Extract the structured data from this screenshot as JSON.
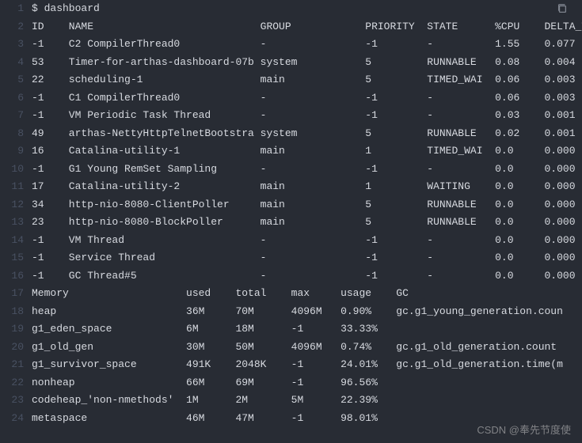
{
  "prompt": "$ dashboard",
  "thread_header": {
    "id": "ID",
    "name": "NAME",
    "group": "GROUP",
    "priority": "PRIORITY",
    "state": "STATE",
    "cpu": "%CPU",
    "delta": "DELTA_T"
  },
  "threads": [
    {
      "id": "-1",
      "name": "C2 CompilerThread0",
      "group": "-",
      "priority": "-1",
      "state": "-",
      "cpu": "1.55",
      "delta": "0.077"
    },
    {
      "id": "53",
      "name": "Timer-for-arthas-dashboard-07b",
      "group": "system",
      "priority": "5",
      "state": "RUNNABLE",
      "cpu": "0.08",
      "delta": "0.004"
    },
    {
      "id": "22",
      "name": "scheduling-1",
      "group": "main",
      "priority": "5",
      "state": "TIMED_WAI",
      "cpu": "0.06",
      "delta": "0.003"
    },
    {
      "id": "-1",
      "name": "C1 CompilerThread0",
      "group": "-",
      "priority": "-1",
      "state": "-",
      "cpu": "0.06",
      "delta": "0.003"
    },
    {
      "id": "-1",
      "name": "VM Periodic Task Thread",
      "group": "-",
      "priority": "-1",
      "state": "-",
      "cpu": "0.03",
      "delta": "0.001"
    },
    {
      "id": "49",
      "name": "arthas-NettyHttpTelnetBootstra",
      "group": "system",
      "priority": "5",
      "state": "RUNNABLE",
      "cpu": "0.02",
      "delta": "0.001"
    },
    {
      "id": "16",
      "name": "Catalina-utility-1",
      "group": "main",
      "priority": "1",
      "state": "TIMED_WAI",
      "cpu": "0.0",
      "delta": "0.000"
    },
    {
      "id": "-1",
      "name": "G1 Young RemSet Sampling",
      "group": "-",
      "priority": "-1",
      "state": "-",
      "cpu": "0.0",
      "delta": "0.000"
    },
    {
      "id": "17",
      "name": "Catalina-utility-2",
      "group": "main",
      "priority": "1",
      "state": "WAITING",
      "cpu": "0.0",
      "delta": "0.000"
    },
    {
      "id": "34",
      "name": "http-nio-8080-ClientPoller",
      "group": "main",
      "priority": "5",
      "state": "RUNNABLE",
      "cpu": "0.0",
      "delta": "0.000"
    },
    {
      "id": "23",
      "name": "http-nio-8080-BlockPoller",
      "group": "main",
      "priority": "5",
      "state": "RUNNABLE",
      "cpu": "0.0",
      "delta": "0.000"
    },
    {
      "id": "-1",
      "name": "VM Thread",
      "group": "-",
      "priority": "-1",
      "state": "-",
      "cpu": "0.0",
      "delta": "0.000"
    },
    {
      "id": "-1",
      "name": "Service Thread",
      "group": "-",
      "priority": "-1",
      "state": "-",
      "cpu": "0.0",
      "delta": "0.000"
    },
    {
      "id": "-1",
      "name": "GC Thread#5",
      "group": "-",
      "priority": "-1",
      "state": "-",
      "cpu": "0.0",
      "delta": "0.000"
    }
  ],
  "memory_header": {
    "name": "Memory",
    "used": "used",
    "total": "total",
    "max": "max",
    "usage": "usage",
    "gc": "GC"
  },
  "memory": [
    {
      "name": "heap",
      "used": "36M",
      "total": "70M",
      "max": "4096M",
      "usage": "0.90%",
      "gc": "gc.g1_young_generation.coun"
    },
    {
      "name": "g1_eden_space",
      "used": "6M",
      "total": "18M",
      "max": "-1",
      "usage": "33.33%",
      "gc": ""
    },
    {
      "name": "g1_old_gen",
      "used": "30M",
      "total": "50M",
      "max": "4096M",
      "usage": "0.74%",
      "gc": "gc.g1_old_generation.count"
    },
    {
      "name": "g1_survivor_space",
      "used": "491K",
      "total": "2048K",
      "max": "-1",
      "usage": "24.01%",
      "gc": "gc.g1_old_generation.time(m"
    },
    {
      "name": "nonheap",
      "used": "66M",
      "total": "69M",
      "max": "-1",
      "usage": "96.56%",
      "gc": ""
    },
    {
      "name": "codeheap_'non-nmethods'",
      "used": "1M",
      "total": "2M",
      "max": "5M",
      "usage": "22.39%",
      "gc": ""
    },
    {
      "name": "metaspace",
      "used": "46M",
      "total": "47M",
      "max": "-1",
      "usage": "98.01%",
      "gc": ""
    }
  ],
  "watermark": "CSDN @奉先节度使"
}
